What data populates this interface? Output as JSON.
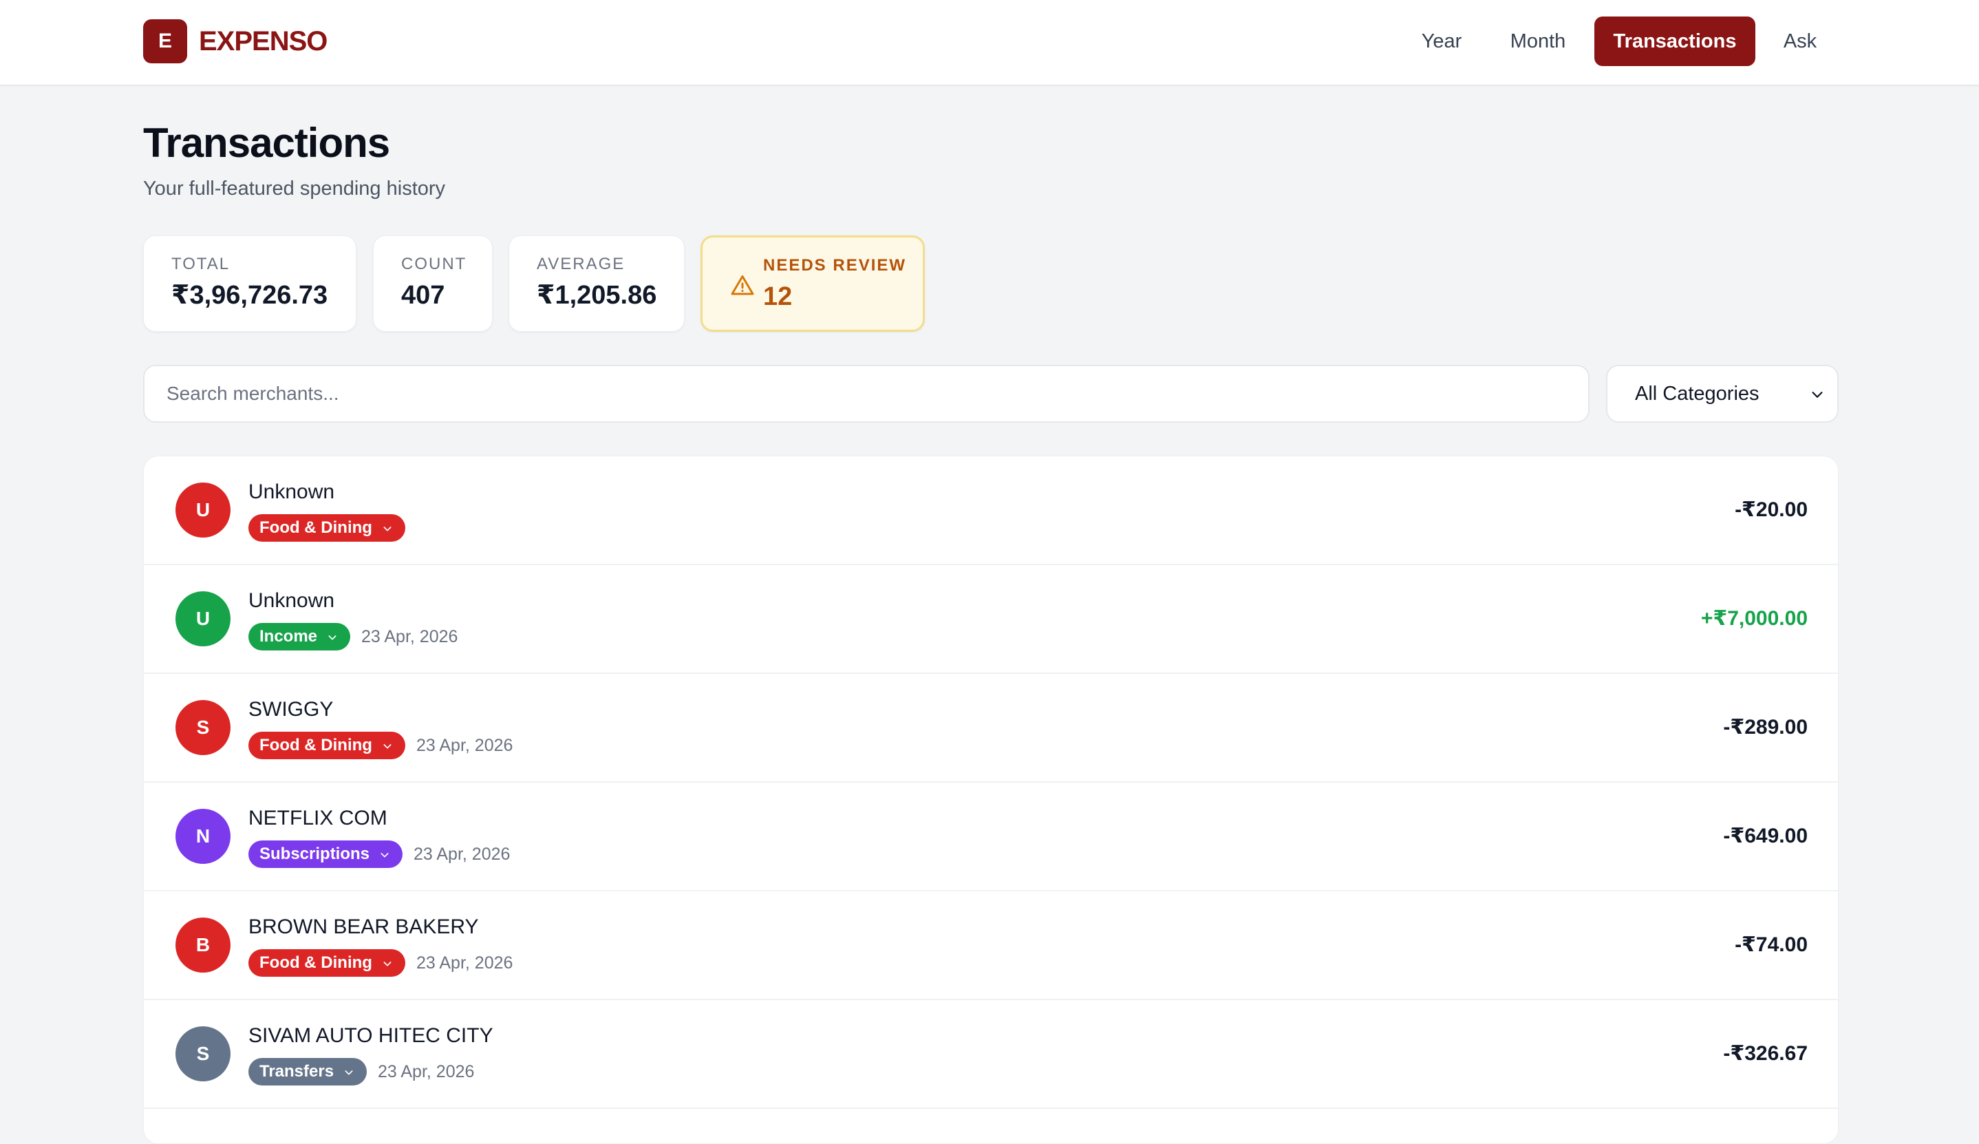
{
  "brand": {
    "mark": "E",
    "name": "EXPENSO",
    "color": "#8b1414"
  },
  "nav": {
    "items": [
      {
        "label": "Year",
        "active": false
      },
      {
        "label": "Month",
        "active": false
      },
      {
        "label": "Transactions",
        "active": true
      },
      {
        "label": "Ask",
        "active": false
      }
    ]
  },
  "page": {
    "title": "Transactions",
    "subtitle": "Your full-featured spending history"
  },
  "stats": {
    "total": {
      "label": "TOTAL",
      "value": "₹3,96,726.73"
    },
    "count": {
      "label": "COUNT",
      "value": "407"
    },
    "average": {
      "label": "AVERAGE",
      "value": "₹1,205.86"
    },
    "needs_review": {
      "label": "NEEDS REVIEW",
      "value": "12",
      "icon": "warning-icon"
    }
  },
  "filters": {
    "search_placeholder": "Search merchants...",
    "category_value": "All Categories"
  },
  "transactions": [
    {
      "initial": "U",
      "merchant": "Unknown",
      "category": "Food & Dining",
      "date": "",
      "amount": "-₹20.00",
      "color": "#dc2626",
      "positive": false
    },
    {
      "initial": "U",
      "merchant": "Unknown",
      "category": "Income",
      "date": "23 Apr, 2026",
      "amount": "+₹7,000.00",
      "color": "#16a34a",
      "positive": true
    },
    {
      "initial": "S",
      "merchant": "SWIGGY",
      "category": "Food & Dining",
      "date": "23 Apr, 2026",
      "amount": "-₹289.00",
      "color": "#dc2626",
      "positive": false
    },
    {
      "initial": "N",
      "merchant": "NETFLIX COM",
      "category": "Subscriptions",
      "date": "23 Apr, 2026",
      "amount": "-₹649.00",
      "color": "#7c3aed",
      "positive": false
    },
    {
      "initial": "B",
      "merchant": "BROWN BEAR BAKERY",
      "category": "Food & Dining",
      "date": "23 Apr, 2026",
      "amount": "-₹74.00",
      "color": "#dc2626",
      "positive": false
    },
    {
      "initial": "S",
      "merchant": "SIVAM AUTO HITEC CITY",
      "category": "Transfers",
      "date": "23 Apr, 2026",
      "amount": "-₹326.67",
      "color": "#64748b",
      "positive": false
    }
  ]
}
